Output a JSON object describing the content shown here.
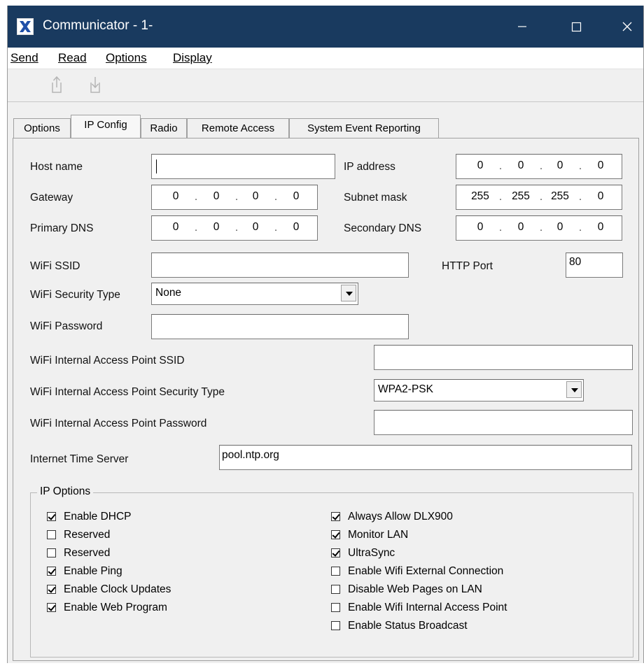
{
  "window": {
    "title": "Communicator - 1-"
  },
  "menu": {
    "send": "Send",
    "read": "Read",
    "options": "Options",
    "display": "Display"
  },
  "toolbar": {
    "upload_icon": "upload-icon",
    "download_icon": "download-icon"
  },
  "tabs": [
    {
      "label": "Options",
      "active": false
    },
    {
      "label": "IP Config",
      "active": true
    },
    {
      "label": "Radio",
      "active": false
    },
    {
      "label": "Remote Access",
      "active": false
    },
    {
      "label": "System Event Reporting",
      "active": false
    }
  ],
  "form": {
    "host_name": {
      "label": "Host name",
      "value": ""
    },
    "ip_address": {
      "label": "IP address",
      "octets": [
        "0",
        "0",
        "0",
        "0"
      ]
    },
    "gateway": {
      "label": "Gateway",
      "octets": [
        "0",
        "0",
        "0",
        "0"
      ]
    },
    "subnet_mask": {
      "label": "Subnet mask",
      "octets": [
        "255",
        "255",
        "255",
        "0"
      ]
    },
    "primary_dns": {
      "label": "Primary DNS",
      "octets": [
        "0",
        "0",
        "0",
        "0"
      ]
    },
    "secondary_dns": {
      "label": "Secondary DNS",
      "octets": [
        "0",
        "0",
        "0",
        "0"
      ]
    },
    "wifi_ssid": {
      "label": "WiFi SSID",
      "value": ""
    },
    "http_port": {
      "label": "HTTP Port",
      "value": "80"
    },
    "wifi_security_type": {
      "label": "WiFi Security Type",
      "value": "None"
    },
    "wifi_password": {
      "label": "WiFi Password",
      "value": ""
    },
    "ap_ssid": {
      "label": "WiFi Internal Access Point SSID",
      "value": ""
    },
    "ap_security_type": {
      "label": "WiFi Internal Access Point Security Type",
      "value": "WPA2-PSK"
    },
    "ap_password": {
      "label": "WiFi Internal Access Point Password",
      "value": ""
    },
    "time_server": {
      "label": "Internet Time Server",
      "value": "pool.ntp.org"
    }
  },
  "ip_options": {
    "title": "IP Options",
    "left": [
      {
        "label": "Enable DHCP",
        "checked": true
      },
      {
        "label": "Reserved",
        "checked": false
      },
      {
        "label": "Reserved",
        "checked": false
      },
      {
        "label": "Enable Ping",
        "checked": true
      },
      {
        "label": "Enable Clock Updates",
        "checked": true
      },
      {
        "label": "Enable Web Program",
        "checked": true
      }
    ],
    "right": [
      {
        "label": "Always Allow DLX900",
        "checked": true
      },
      {
        "label": "Monitor LAN",
        "checked": true
      },
      {
        "label": "UltraSync",
        "checked": true
      },
      {
        "label": "Enable Wifi External Connection",
        "checked": false
      },
      {
        "label": "Disable Web Pages on LAN",
        "checked": false
      },
      {
        "label": "Enable Wifi Internal Access Point",
        "checked": false
      },
      {
        "label": "Enable Status Broadcast",
        "checked": false
      }
    ]
  }
}
